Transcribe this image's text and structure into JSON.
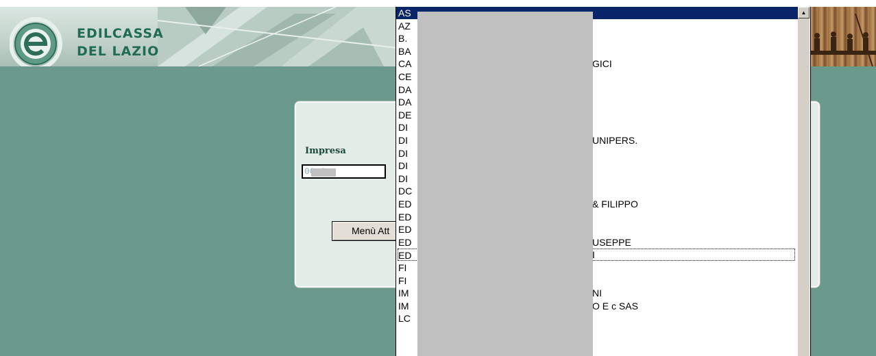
{
  "brand": {
    "line1": "EDILCASSA",
    "line2": "DEL LAZIO",
    "logo_icon": "e-logo-icon"
  },
  "form": {
    "impresa_label": "Impresa",
    "impresa_value": "00   6",
    "menu_button_label": "Menù Att"
  },
  "dropdown": {
    "items": [
      {
        "prefix": "AS",
        "suffix": ""
      },
      {
        "prefix": "AZ",
        "suffix": ""
      },
      {
        "prefix": "B.",
        "suffix": ""
      },
      {
        "prefix": "BA",
        "suffix": ""
      },
      {
        "prefix": "CA",
        "suffix": "GICI"
      },
      {
        "prefix": "CE",
        "suffix": ""
      },
      {
        "prefix": "DA",
        "suffix": ""
      },
      {
        "prefix": "DA",
        "suffix": ""
      },
      {
        "prefix": "DE",
        "suffix": ""
      },
      {
        "prefix": "DI",
        "suffix": ""
      },
      {
        "prefix": "DI",
        "suffix": "UNIPERS."
      },
      {
        "prefix": "DI",
        "suffix": ""
      },
      {
        "prefix": "DI",
        "suffix": ""
      },
      {
        "prefix": "DI",
        "suffix": ""
      },
      {
        "prefix": "DC",
        "suffix": ""
      },
      {
        "prefix": "ED",
        "suffix": "& FILIPPO"
      },
      {
        "prefix": "ED",
        "suffix": ""
      },
      {
        "prefix": "ED",
        "suffix": ""
      },
      {
        "prefix": "ED",
        "suffix": "USEPPE"
      },
      {
        "prefix": "ED",
        "suffix": "I"
      },
      {
        "prefix": "FI",
        "suffix": ""
      },
      {
        "prefix": "FI",
        "suffix": ""
      },
      {
        "prefix": "IM",
        "suffix": "NI"
      },
      {
        "prefix": "IM",
        "suffix": "O E c SAS"
      },
      {
        "prefix": "LC",
        "suffix": ""
      }
    ],
    "selected_index": 0,
    "focused_index": 19,
    "scroll_up_icon": "scroll-up-arrow-icon"
  },
  "colors": {
    "background": "#6b9a8c",
    "selection": "#0a246a",
    "brand_text": "#1f6b55"
  }
}
